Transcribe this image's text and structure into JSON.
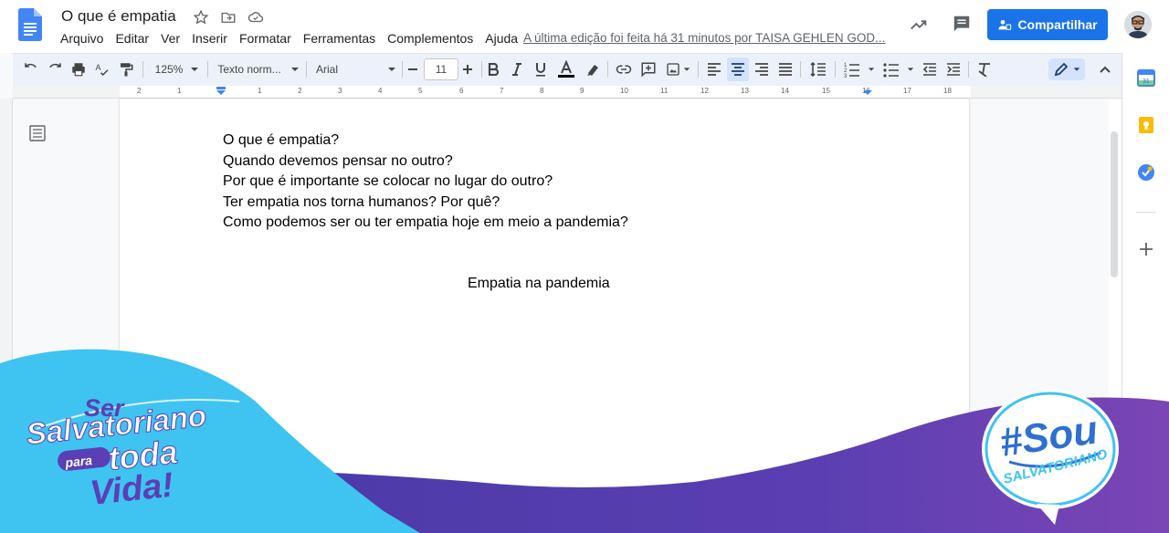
{
  "doc": {
    "title": "O que é empatia"
  },
  "menu": [
    "Arquivo",
    "Editar",
    "Ver",
    "Inserir",
    "Formatar",
    "Ferramentas",
    "Complementos",
    "Ajuda"
  ],
  "last_edit": "A última edição foi feita há 31 minutos por TAISA GEHLEN GOD...",
  "share": {
    "label": "Compartilhar"
  },
  "toolbar": {
    "zoom": "125%",
    "style": "Texto norm...",
    "font": "Arial",
    "font_size": "11"
  },
  "ruler": {
    "numbers": [
      "2",
      "1",
      "1",
      "2",
      "3",
      "4",
      "5",
      "6",
      "7",
      "8",
      "9",
      "10",
      "11",
      "12",
      "13",
      "14",
      "15",
      "16",
      "17",
      "18"
    ]
  },
  "content": {
    "lines": [
      "O que é empatia?",
      "Quando devemos pensar no outro?",
      "Por que é importante se colocar no lugar do outro?",
      "Ter empatia nos torna humanos? Por quê?",
      "Como podemos ser ou ter empatia hoje em meio a pandemia?"
    ],
    "centered": "Empatia na pandemia"
  },
  "banner": {
    "left_line1": "Ser",
    "left_line2": "Salvatoriano",
    "left_line3a": "para",
    "left_line3b": "toda",
    "left_line4": "Vida!",
    "right_main": "#Sou",
    "right_sub": "SALVATORIANO"
  },
  "colors": {
    "accent": "#1a73e8",
    "banner_cyan": "#3ec3f0",
    "banner_purple": "#5a3fae"
  }
}
